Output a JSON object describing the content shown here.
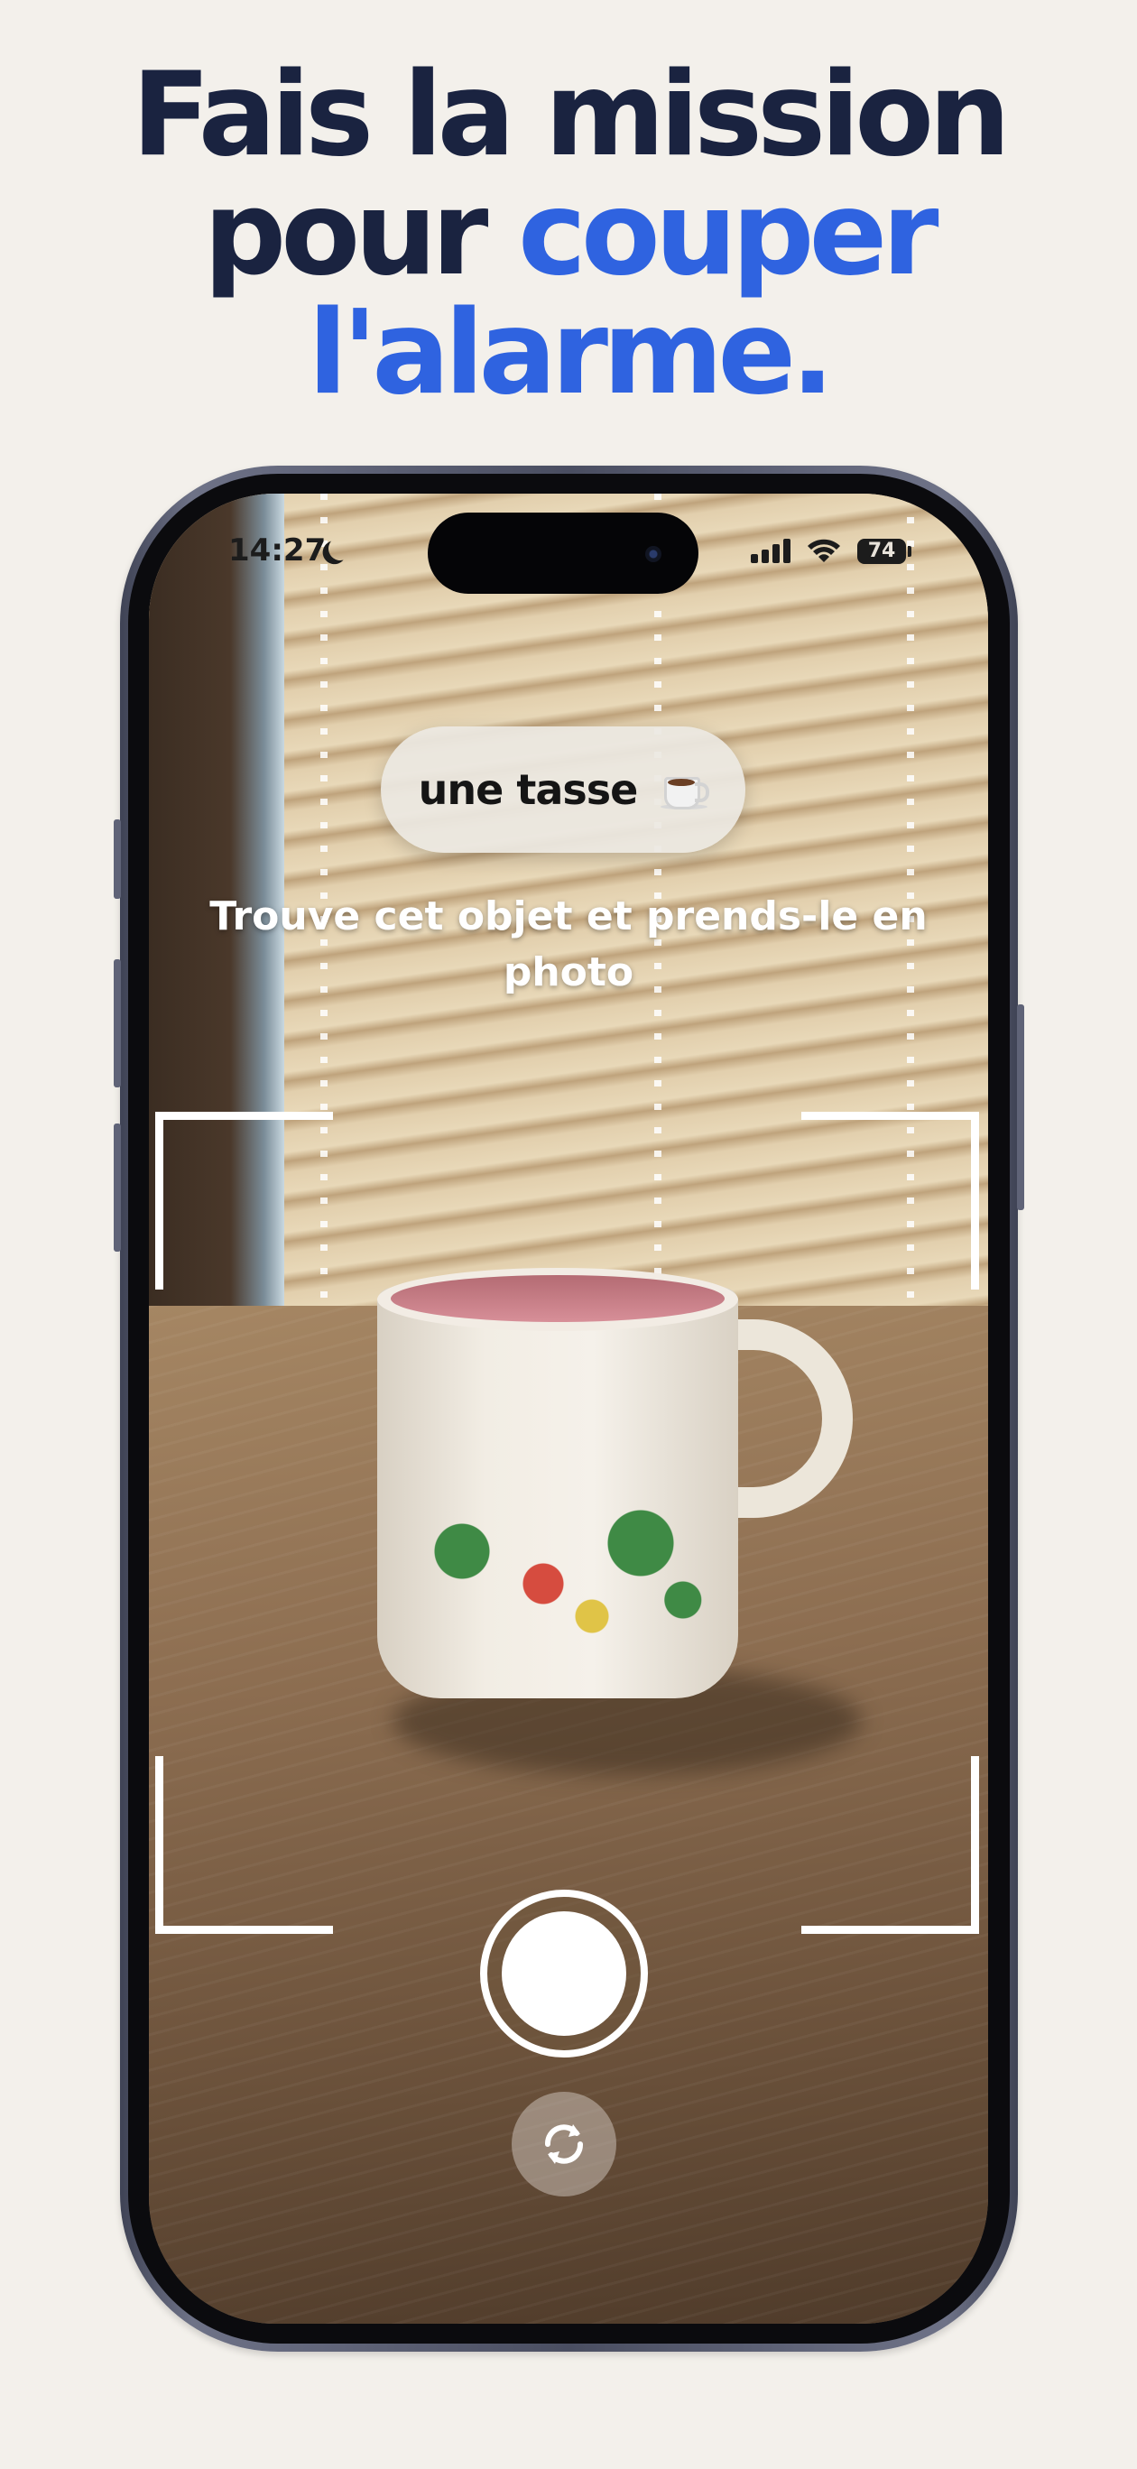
{
  "headline": {
    "line1": "Fais la mission",
    "line2_plain": "pour",
    "line2_accent": "couper",
    "line3_accent": "l'alarme."
  },
  "status_bar": {
    "time": "14:27",
    "battery": "74",
    "icons": [
      "moon-icon",
      "signal-icon",
      "wifi-icon",
      "battery-icon"
    ]
  },
  "mission": {
    "object_label": "une tasse",
    "object_icon": "coffee-cup-icon",
    "instruction": "Trouve cet objet et prends-le en photo"
  },
  "camera": {
    "controls": [
      "shutter-button",
      "flip-camera-button"
    ]
  },
  "colors": {
    "background": "#f3f0eb",
    "headline": "#1a2340",
    "accent": "#2f63e0"
  }
}
